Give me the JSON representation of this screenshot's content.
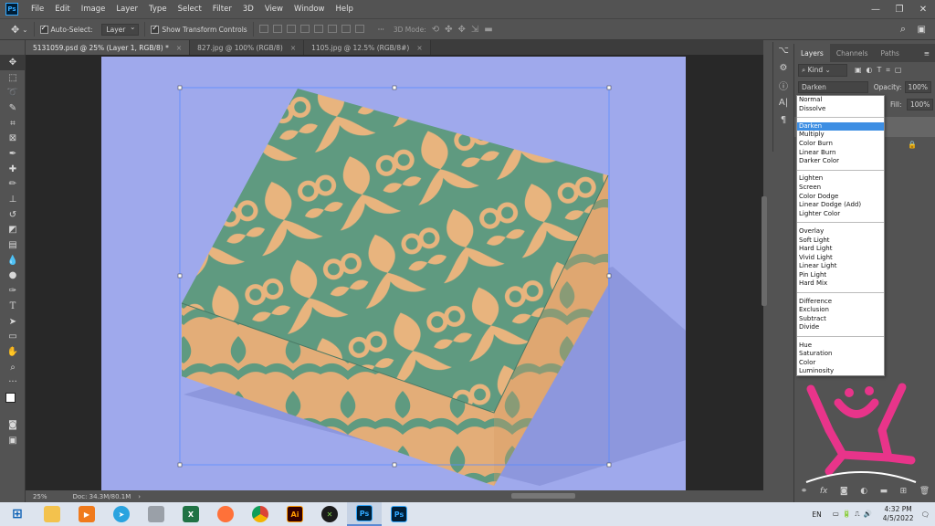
{
  "app": {
    "logo": "Ps",
    "menus": [
      "File",
      "Edit",
      "Image",
      "Layer",
      "Type",
      "Select",
      "Filter",
      "3D",
      "View",
      "Window",
      "Help"
    ],
    "window_controls": [
      "minimize-icon",
      "maximize-icon",
      "close-icon"
    ]
  },
  "options": {
    "auto_select_label": "Auto-Select:",
    "auto_select_value": "Layer",
    "transform_label": "Show Transform Controls",
    "mode_3d_label": "3D Mode:"
  },
  "tabs": [
    {
      "label": "5131059.psd @ 25% (Layer 1, RGB/8) *"
    },
    {
      "label": "827.jpg @ 100% (RGB/8)"
    },
    {
      "label": "1105.jpg @ 12.5% (RGB/8#)"
    }
  ],
  "status": {
    "zoom": "25%",
    "doc": "Doc: 34.3M/80.1M"
  },
  "layers_panel": {
    "tabs": [
      "Layers",
      "Channels",
      "Paths"
    ],
    "kind_label": "Kind",
    "blend_mode": "Darken",
    "opacity_label": "Opacity:",
    "opacity_value": "100%",
    "fill_label": "Fill:",
    "fill_value": "100%"
  },
  "blend_modes": [
    {
      "group": [
        "Normal",
        "Dissolve"
      ]
    },
    {
      "group": [
        "Darken",
        "Multiply",
        "Color Burn",
        "Linear Burn",
        "Darker Color"
      ]
    },
    {
      "group": [
        "Lighten",
        "Screen",
        "Color Dodge",
        "Linear Dodge (Add)",
        "Lighter Color"
      ]
    },
    {
      "group": [
        "Overlay",
        "Soft Light",
        "Hard Light",
        "Vivid Light",
        "Linear Light",
        "Pin Light",
        "Hard Mix"
      ]
    },
    {
      "group": [
        "Difference",
        "Exclusion",
        "Subtract",
        "Divide"
      ]
    },
    {
      "group": [
        "Hue",
        "Saturation",
        "Color",
        "Luminosity"
      ]
    }
  ],
  "blend_selected": "Darken",
  "taskbar": {
    "apps": [
      "start-icon",
      "file-explorer-icon",
      "media-player-icon",
      "telegram-icon",
      "calculator-icon",
      "excel-icon",
      "firefox-icon",
      "chrome-icon",
      "illustrator-icon",
      "xbox-icon",
      "photoshop-icon",
      "photoshop-icon-2"
    ],
    "language": "EN",
    "time": "4:32 PM",
    "date": "4/5/2022"
  },
  "colors": {
    "canvas_bg": "#9fa9ec",
    "box_green": "#5f9a80",
    "box_pattern": "#e8b47e",
    "watermark": "#e8348a"
  }
}
